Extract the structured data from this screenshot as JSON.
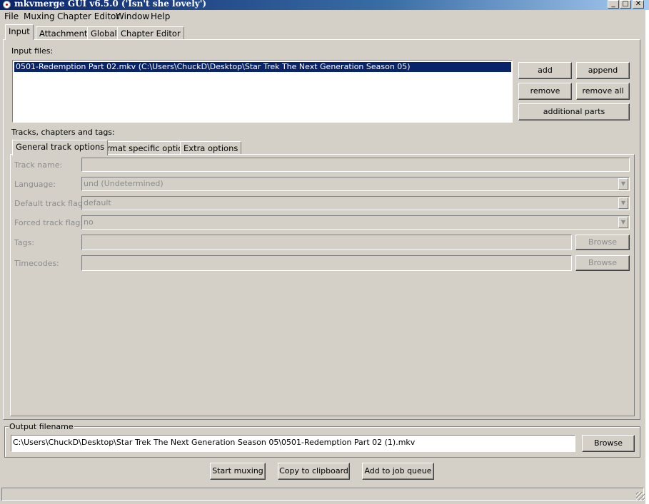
{
  "window": {
    "title": "mkvmerge GUI v6.5.0 ('Isn't she lovely')"
  },
  "menu": [
    "File",
    "Muxing",
    "Chapter Editor",
    "Window",
    "Help"
  ],
  "tabs": [
    "Input",
    "Attachments",
    "Global",
    "Chapter Editor"
  ],
  "input": {
    "files_label": "Input files:",
    "files": [
      "0501-Redemption Part 02.mkv (C:\\Users\\ChuckD\\Desktop\\Star Trek The Next Generation Season 05)"
    ],
    "buttons": {
      "add": "add",
      "append": "append",
      "remove": "remove",
      "remove_all": "remove all",
      "additional_parts": "additional parts"
    },
    "tracks_label": "Tracks, chapters and tags:",
    "subtabs": [
      "General track options",
      "Format specific options",
      "Extra options"
    ],
    "fields": {
      "track_name": {
        "label": "Track name:",
        "value": ""
      },
      "language": {
        "label": "Language:",
        "value": "und (Undetermined)"
      },
      "default_flag": {
        "label": "Default track flag:",
        "value": "default"
      },
      "forced_flag": {
        "label": "Forced track flag:",
        "value": "no"
      },
      "tags": {
        "label": "Tags:",
        "value": "",
        "browse": "Browse"
      },
      "timecodes": {
        "label": "Timecodes:",
        "value": "",
        "browse": "Browse"
      }
    }
  },
  "output": {
    "label": "Output filename",
    "value": "C:\\Users\\ChuckD\\Desktop\\Star Trek The Next Generation Season 05\\0501-Redemption Part 02 (1).mkv",
    "browse": "Browse"
  },
  "actions": {
    "start": "Start muxing",
    "copy": "Copy to clipboard",
    "queue": "Add to job queue"
  },
  "icons": {
    "app": "mkvmerge-app-icon",
    "minimize": "minimize-icon",
    "maximize": "maximize-icon",
    "close": "close-icon",
    "dropdown": "chevron-down-icon",
    "grip": "resize-grip-icon"
  }
}
